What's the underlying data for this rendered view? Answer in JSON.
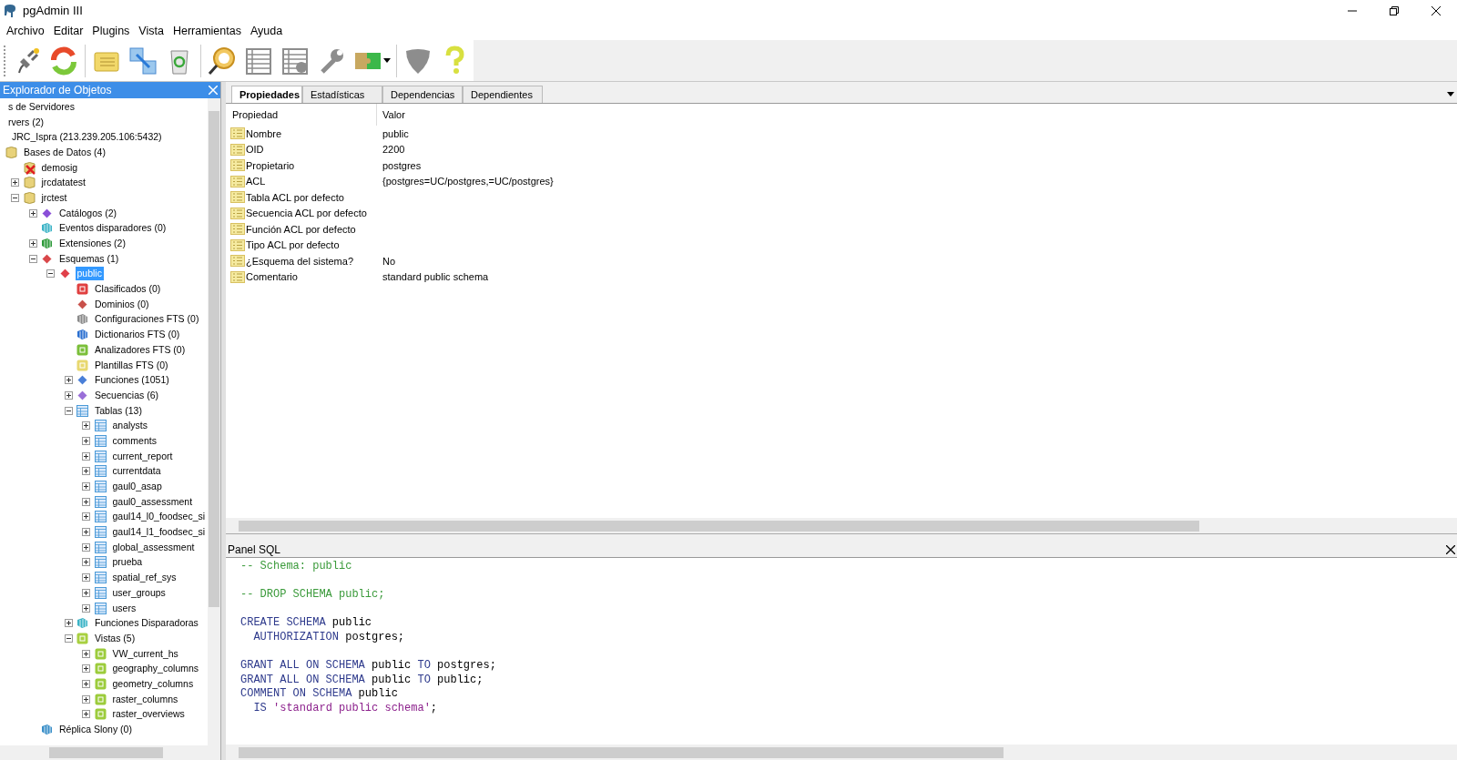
{
  "window": {
    "title": "pgAdmin III"
  },
  "menu": [
    "Archivo",
    "Editar",
    "Plugins",
    "Vista",
    "Herramientas",
    "Ayuda"
  ],
  "toolbar": [
    {
      "kind": "plug",
      "disabled": false
    },
    {
      "kind": "refresh",
      "disabled": false
    },
    {
      "kind": "sep"
    },
    {
      "kind": "properties",
      "disabled": false
    },
    {
      "kind": "move",
      "disabled": false
    },
    {
      "kind": "trash",
      "disabled": false
    },
    {
      "kind": "sep"
    },
    {
      "kind": "query",
      "disabled": false
    },
    {
      "kind": "grid",
      "disabled": true
    },
    {
      "kind": "grid-filter",
      "disabled": true
    },
    {
      "kind": "wrench",
      "disabled": true
    },
    {
      "kind": "puzzle",
      "disabled": false
    },
    {
      "kind": "sep"
    },
    {
      "kind": "shield",
      "disabled": true
    },
    {
      "kind": "help",
      "disabled": false
    }
  ],
  "explorer": {
    "title": "Explorador de Objetos",
    "tree": [
      {
        "label": "s de Servidores",
        "selected": false,
        "children": [
          {
            "label": "rvers (2)",
            "selected": false,
            "children": [
              {
                "label": "JRC_Ispra (213.239.205.106:5432)",
                "selected": false,
                "children": [
                  {
                    "label": "Bases de Datos (4)",
                    "kind": "database",
                    "selected": false,
                    "children": [
                      {
                        "label": "demosig",
                        "kind": "database-error",
                        "selected": false
                      },
                      {
                        "label": "jrcdatatest",
                        "kind": "database",
                        "expanded": false,
                        "selected": false
                      },
                      {
                        "label": "jrctest",
                        "kind": "database",
                        "expanded": true,
                        "selected": false,
                        "children": [
                          {
                            "label": "Catálogos (2)",
                            "kind": "catalog",
                            "expanded": false,
                            "selected": false
                          },
                          {
                            "label": "Eventos disparadores (0)",
                            "kind": "trigger",
                            "selected": false
                          },
                          {
                            "label": "Extensiones (2)",
                            "kind": "extension",
                            "expanded": false,
                            "selected": false
                          },
                          {
                            "label": "Esquemas (1)",
                            "kind": "schema-group",
                            "expanded": true,
                            "selected": false,
                            "children": [
                              {
                                "label": "public",
                                "kind": "schema",
                                "expanded": true,
                                "selected": true,
                                "children": [
                                  {
                                    "label": "Clasificados (0)",
                                    "kind": "collation",
                                    "selected": false
                                  },
                                  {
                                    "label": "Dominios (0)",
                                    "kind": "domain",
                                    "selected": false
                                  },
                                  {
                                    "label": "Configuraciones FTS (0)",
                                    "kind": "fts-config",
                                    "selected": false
                                  },
                                  {
                                    "label": "Dictionarios FTS (0)",
                                    "kind": "fts-dict",
                                    "selected": false
                                  },
                                  {
                                    "label": "Analizadores FTS (0)",
                                    "kind": "fts-parser",
                                    "selected": false
                                  },
                                  {
                                    "label": "Plantillas FTS (0)",
                                    "kind": "fts-template",
                                    "selected": false
                                  },
                                  {
                                    "label": "Funciones (1051)",
                                    "kind": "function",
                                    "expanded": false,
                                    "selected": false
                                  },
                                  {
                                    "label": "Secuencias (6)",
                                    "kind": "sequence",
                                    "expanded": false,
                                    "selected": false
                                  },
                                  {
                                    "label": "Tablas (13)",
                                    "kind": "table-group",
                                    "expanded": true,
                                    "selected": false,
                                    "children": [
                                      {
                                        "label": "analysts",
                                        "kind": "table",
                                        "expanded": false,
                                        "selected": false
                                      },
                                      {
                                        "label": "comments",
                                        "kind": "table",
                                        "expanded": false,
                                        "selected": false
                                      },
                                      {
                                        "label": "current_report",
                                        "kind": "table",
                                        "expanded": false,
                                        "selected": false
                                      },
                                      {
                                        "label": "currentdata",
                                        "kind": "table",
                                        "expanded": false,
                                        "selected": false
                                      },
                                      {
                                        "label": "gaul0_asap",
                                        "kind": "table",
                                        "expanded": false,
                                        "selected": false
                                      },
                                      {
                                        "label": "gaul0_assessment",
                                        "kind": "table",
                                        "expanded": false,
                                        "selected": false
                                      },
                                      {
                                        "label": "gaul14_l0_foodsec_si",
                                        "kind": "table",
                                        "expanded": false,
                                        "selected": false
                                      },
                                      {
                                        "label": "gaul14_l1_foodsec_si",
                                        "kind": "table",
                                        "expanded": false,
                                        "selected": false
                                      },
                                      {
                                        "label": "global_assessment",
                                        "kind": "table",
                                        "expanded": false,
                                        "selected": false
                                      },
                                      {
                                        "label": "prueba",
                                        "kind": "table",
                                        "expanded": false,
                                        "selected": false
                                      },
                                      {
                                        "label": "spatial_ref_sys",
                                        "kind": "table",
                                        "expanded": false,
                                        "selected": false
                                      },
                                      {
                                        "label": "user_groups",
                                        "kind": "table",
                                        "expanded": false,
                                        "selected": false
                                      },
                                      {
                                        "label": "users",
                                        "kind": "table",
                                        "expanded": false,
                                        "selected": false
                                      }
                                    ]
                                  },
                                  {
                                    "label": "Funciones Disparadoras",
                                    "kind": "trigger-function",
                                    "expanded": false,
                                    "selected": false
                                  },
                                  {
                                    "label": "Vistas (5)",
                                    "kind": "view-group",
                                    "expanded": true,
                                    "selected": false,
                                    "children": [
                                      {
                                        "label": "VW_current_hs",
                                        "kind": "view",
                                        "expanded": false,
                                        "selected": false
                                      },
                                      {
                                        "label": "geography_columns",
                                        "kind": "view",
                                        "expanded": false,
                                        "selected": false
                                      },
                                      {
                                        "label": "geometry_columns",
                                        "kind": "view",
                                        "expanded": false,
                                        "selected": false
                                      },
                                      {
                                        "label": "raster_columns",
                                        "kind": "view",
                                        "expanded": false,
                                        "selected": false
                                      },
                                      {
                                        "label": "raster_overviews",
                                        "kind": "view",
                                        "expanded": false,
                                        "selected": false
                                      }
                                    ]
                                  }
                                ]
                              }
                            ]
                          },
                          {
                            "label": "Réplica Slony (0)",
                            "kind": "slony",
                            "selected": false
                          }
                        ]
                      }
                    ]
                  }
                ]
              }
            ]
          }
        ]
      }
    ]
  },
  "properties": {
    "tabs": [
      {
        "label": "Propiedades",
        "selected": true
      },
      {
        "label": "Estadísticas",
        "selected": false
      },
      {
        "label": "Dependencias",
        "selected": false
      },
      {
        "label": "Dependientes",
        "selected": false
      }
    ],
    "columns": [
      "Propiedad",
      "Valor"
    ],
    "rows": [
      {
        "name": "Nombre",
        "value": "public"
      },
      {
        "name": "OID",
        "value": "2200"
      },
      {
        "name": "Propietario",
        "value": "postgres"
      },
      {
        "name": "ACL",
        "value": "{postgres=UC/postgres,=UC/postgres}"
      },
      {
        "name": "Tabla ACL por defecto"
      },
      {
        "name": "Secuencia ACL por defecto"
      },
      {
        "name": "Función ACL por defecto"
      },
      {
        "name": "Tipo ACL por defecto"
      },
      {
        "name": "¿Esquema del sistema?",
        "value": "No"
      },
      {
        "name": "Comentario",
        "value": "standard public schema"
      }
    ]
  },
  "sql_panel": {
    "title": "Panel SQL",
    "lines": [
      {
        "kind": "code",
        "segments": [
          {
            "kind": "comment",
            "text": "-- Schema: public"
          }
        ]
      },
      {
        "kind": "blank"
      },
      {
        "kind": "code",
        "segments": [
          {
            "kind": "comment",
            "text": "-- DROP SCHEMA public;"
          }
        ]
      },
      {
        "kind": "blank"
      },
      {
        "kind": "code",
        "segments": [
          {
            "kind": "keyword",
            "text": "CREATE SCHEMA"
          },
          {
            "kind": "plain",
            "text": " public"
          }
        ]
      },
      {
        "kind": "code",
        "segments": [
          {
            "kind": "keyword",
            "text": "  AUTHORIZATION"
          },
          {
            "kind": "plain",
            "text": " postgres;"
          }
        ]
      },
      {
        "kind": "blank"
      },
      {
        "kind": "code",
        "segments": [
          {
            "kind": "keyword",
            "text": "GRANT ALL ON SCHEMA"
          },
          {
            "kind": "plain",
            "text": " public "
          },
          {
            "kind": "keyword",
            "text": "TO"
          },
          {
            "kind": "plain",
            "text": " postgres;"
          }
        ]
      },
      {
        "kind": "code",
        "segments": [
          {
            "kind": "keyword",
            "text": "GRANT ALL ON SCHEMA"
          },
          {
            "kind": "plain",
            "text": " public "
          },
          {
            "kind": "keyword",
            "text": "TO"
          },
          {
            "kind": "plain",
            "text": " public;"
          }
        ]
      },
      {
        "kind": "code",
        "segments": [
          {
            "kind": "keyword",
            "text": "COMMENT ON SCHEMA"
          },
          {
            "kind": "plain",
            "text": " public"
          }
        ]
      },
      {
        "kind": "code",
        "segments": [
          {
            "kind": "keyword",
            "text": "  IS "
          },
          {
            "kind": "string",
            "text": "'standard public schema'"
          },
          {
            "kind": "plain",
            "text": ";"
          }
        ]
      }
    ]
  }
}
